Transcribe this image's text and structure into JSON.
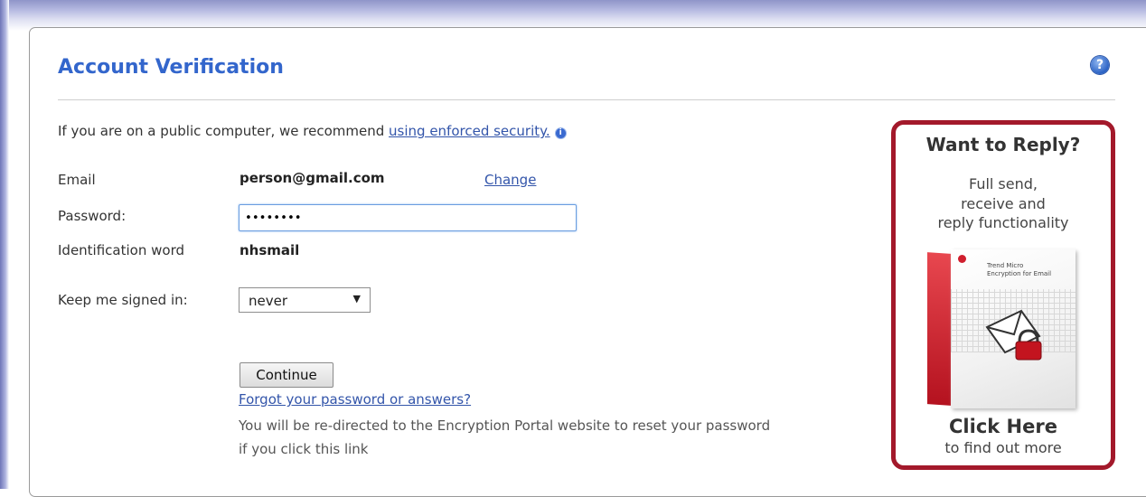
{
  "header": {
    "title": "Account Verification",
    "help_icon": "?"
  },
  "intro": {
    "text": "If you are on a public computer, we recommend ",
    "link": "using enforced security.",
    "info_icon": "i"
  },
  "form": {
    "email_label": "Email",
    "email_value": "person@gmail.com",
    "change_link": "Change",
    "password_label": "Password:",
    "password_value": "••••••••",
    "id_word_label": "Identification word",
    "id_word_value": "nhsmail",
    "keep_signed_label": "Keep me signed in:",
    "keep_signed_value": "never",
    "dropdown_arrow": "▼",
    "continue_label": "Continue",
    "forgot_link": "Forgot your password or answers? ",
    "redirect_note": "You will be re-directed to the Encryption Portal website to reset your password if you click this link"
  },
  "promo": {
    "title": "Want to Reply?",
    "line1": "Full send,",
    "line2": "receive and",
    "line3": "reply functionality",
    "box_label_1": "Trend Micro",
    "box_label_2": "Encryption for Email",
    "click_here": "Click Here",
    "find_out": "to find out more",
    "accent_color": "#a3192b"
  },
  "colors": {
    "title_blue": "#3366cc",
    "link_blue": "#3355aa"
  }
}
